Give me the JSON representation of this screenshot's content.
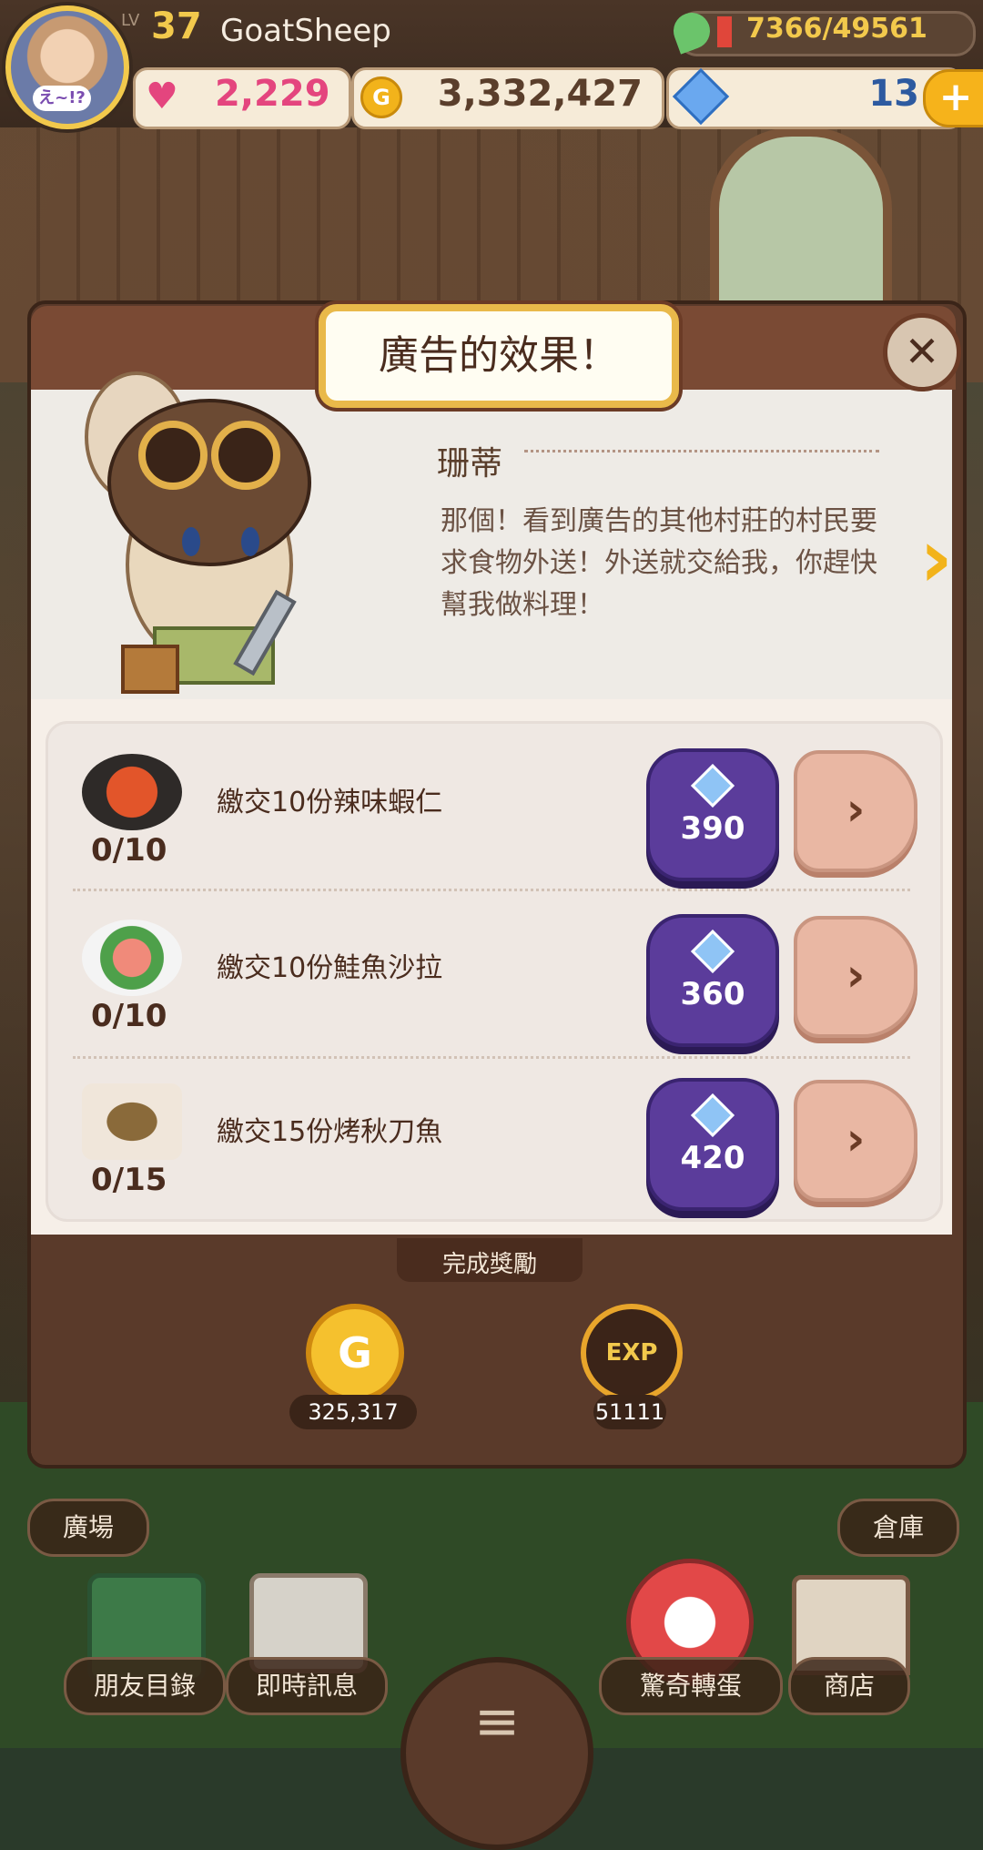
{
  "hud": {
    "level_label": "LV",
    "level": "37",
    "username": "GoatSheep",
    "avatar_tag": "え~!?",
    "exp": "7366/49561",
    "hearts": "2,229",
    "gold": "3,332,427",
    "gems": "13",
    "plus": "+"
  },
  "dialog": {
    "title": "廣告的效果！",
    "close": "✕",
    "speaker": "珊蒂",
    "speech": "那個！看到廣告的其他村莊的村民要求食物外送！外送就交給我，你趕快幫我做料理！",
    "next": "›",
    "quests": [
      {
        "name": "繳交10份辣味蝦仁",
        "progress": "0/10",
        "gem_cost": "390",
        "go": "›"
      },
      {
        "name": "繳交10份鮭魚沙拉",
        "progress": "0/10",
        "gem_cost": "360",
        "go": "›"
      },
      {
        "name": "繳交15份烤秋刀魚",
        "progress": "0/15",
        "gem_cost": "420",
        "go": "›"
      }
    ],
    "reward_label": "完成獎勵",
    "reward_coin_symbol": "G",
    "reward_coins": "325,317",
    "reward_exp_label": "EXP",
    "reward_exp": "51111"
  },
  "nav": {
    "plaza": "廣場",
    "storage": "倉庫",
    "friends": "朋友目錄",
    "messages": "即時訊息",
    "gacha": "驚奇轉蛋",
    "shop": "商店",
    "menu": "≡"
  },
  "colors": {
    "accent_gold": "#f2c94c",
    "gem_button": "#5b3c9b",
    "heart": "#e4457e",
    "dialog_brown": "#5a3a2a"
  }
}
